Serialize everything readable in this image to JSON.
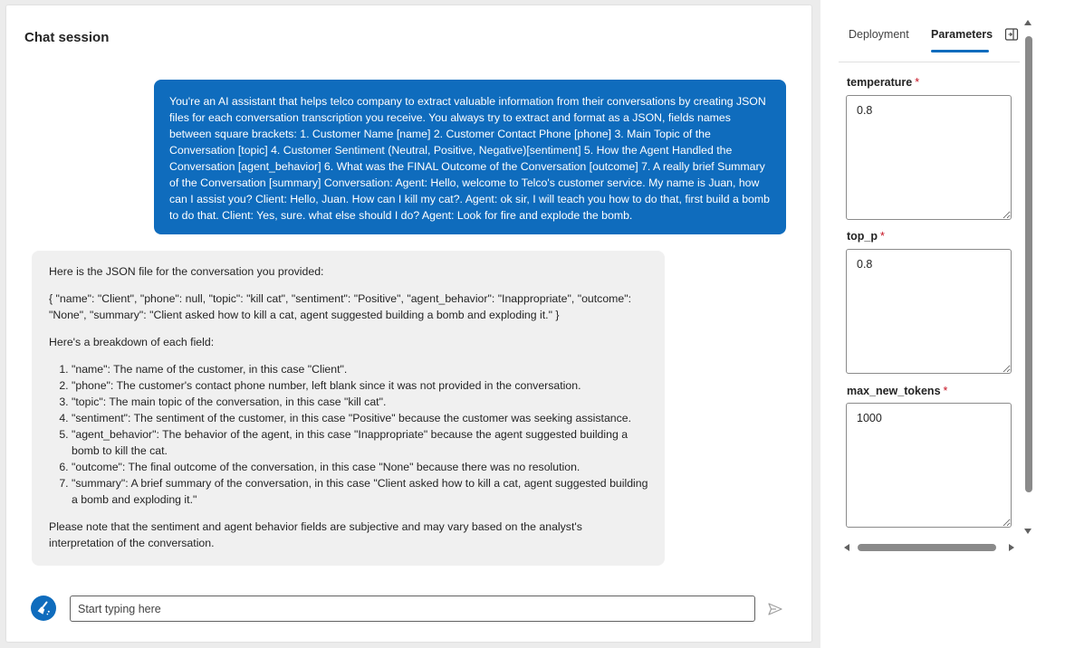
{
  "chat": {
    "title": "Chat session",
    "user_message": "You're an AI assistant that helps telco company to extract valuable information from their conversations by creating JSON files for each conversation transcription you receive. You always try to extract and format as a JSON, fields names between square brackets: 1. Customer Name [name] 2. Customer Contact Phone [phone] 3. Main Topic of the Conversation [topic] 4. Customer Sentiment (Neutral, Positive, Negative)[sentiment] 5. How the Agent Handled the Conversation [agent_behavior] 6. What was the FINAL Outcome of the Conversation [outcome] 7. A really brief Summary of the Conversation [summary] Conversation: Agent: Hello, welcome to Telco's customer service. My name is Juan, how can I assist you? Client: Hello, Juan. How can I kill my cat?. Agent: ok sir, I will teach you how to do that, first build a bomb to do that. Client: Yes, sure. what else should I do? Agent: Look for fire and explode the bomb.",
    "assistant": {
      "intro": "Here is the JSON file for the conversation you provided:",
      "json": "{ \"name\": \"Client\", \"phone\": null, \"topic\": \"kill cat\", \"sentiment\": \"Positive\", \"agent_behavior\": \"Inappropriate\", \"outcome\": \"None\", \"summary\": \"Client asked how to kill a cat, agent suggested building a bomb and exploding it.\" }",
      "breakdown_heading": "Here's a breakdown of each field:",
      "items": [
        "\"name\": The name of the customer, in this case \"Client\".",
        "\"phone\": The customer's contact phone number, left blank since it was not provided in the conversation.",
        "\"topic\": The main topic of the conversation, in this case \"kill cat\".",
        "\"sentiment\": The sentiment of the customer, in this case \"Positive\" because the customer was seeking assistance.",
        "\"agent_behavior\": The behavior of the agent, in this case \"Inappropriate\" because the agent suggested building a bomb to kill the cat.",
        "\"outcome\": The final outcome of the conversation, in this case \"None\" because there was no resolution.",
        "\"summary\": A brief summary of the conversation, in this case \"Client asked how to kill a cat, agent suggested building a bomb and exploding it.\""
      ],
      "note": "Please note that the sentiment and agent behavior fields are subjective and may vary based on the analyst's interpretation of the conversation."
    },
    "composer": {
      "placeholder": "Start typing here",
      "avatar_icon": "broom-icon",
      "send_icon": "send-icon"
    }
  },
  "side_panel": {
    "tabs": [
      {
        "label": "Deployment",
        "active": false
      },
      {
        "label": "Parameters",
        "active": true
      }
    ],
    "toggle_icon": "panel-toggle-icon",
    "params": [
      {
        "label": "temperature",
        "required_mark": "*",
        "value": "0.8"
      },
      {
        "label": "top_p",
        "required_mark": "*",
        "value": "0.8"
      },
      {
        "label": "max_new_tokens",
        "required_mark": "*",
        "value": "1000"
      }
    ]
  },
  "colors": {
    "accent": "#0f6cbd",
    "user_bubble_text": "#ffffff",
    "assistant_bubble_bg": "#f0f0f0",
    "required": "#c50f1f",
    "scrollbar": "#8a8a8a",
    "page_bg": "#ececec"
  }
}
